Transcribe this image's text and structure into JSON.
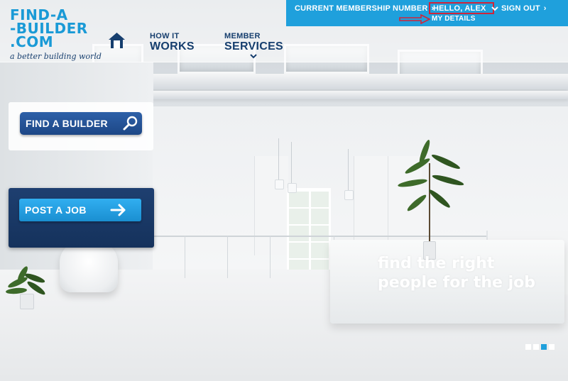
{
  "brand": {
    "logo_line1": "FIND-A",
    "logo_line2": "-BUILDER",
    "logo_line3": ".COM",
    "tagline": "a better building world",
    "primary_color": "#1fa0dc",
    "navy_color": "#163e6e"
  },
  "topbar": {
    "membership_label": "CURRENT MEMBERSHIP NUMBER",
    "hello_label": "HELLO, ALEX",
    "signout_label": "SIGN OUT",
    "my_details_label": "MY DETAILS",
    "highlight_color": "#d0243a"
  },
  "nav": {
    "home_icon": "home-icon",
    "items": [
      {
        "small": "HOW IT",
        "big": "WORKS"
      },
      {
        "small": "MEMBER",
        "big": "SERVICES"
      }
    ]
  },
  "cta": {
    "find_label": "FIND A BUILDER",
    "find_icon": "magnifier-icon",
    "post_label": "POST A JOB",
    "post_icon": "arrow-right-icon"
  },
  "hero": {
    "headline": "find the right people for the job",
    "slides": 4,
    "active_slide": 3
  }
}
